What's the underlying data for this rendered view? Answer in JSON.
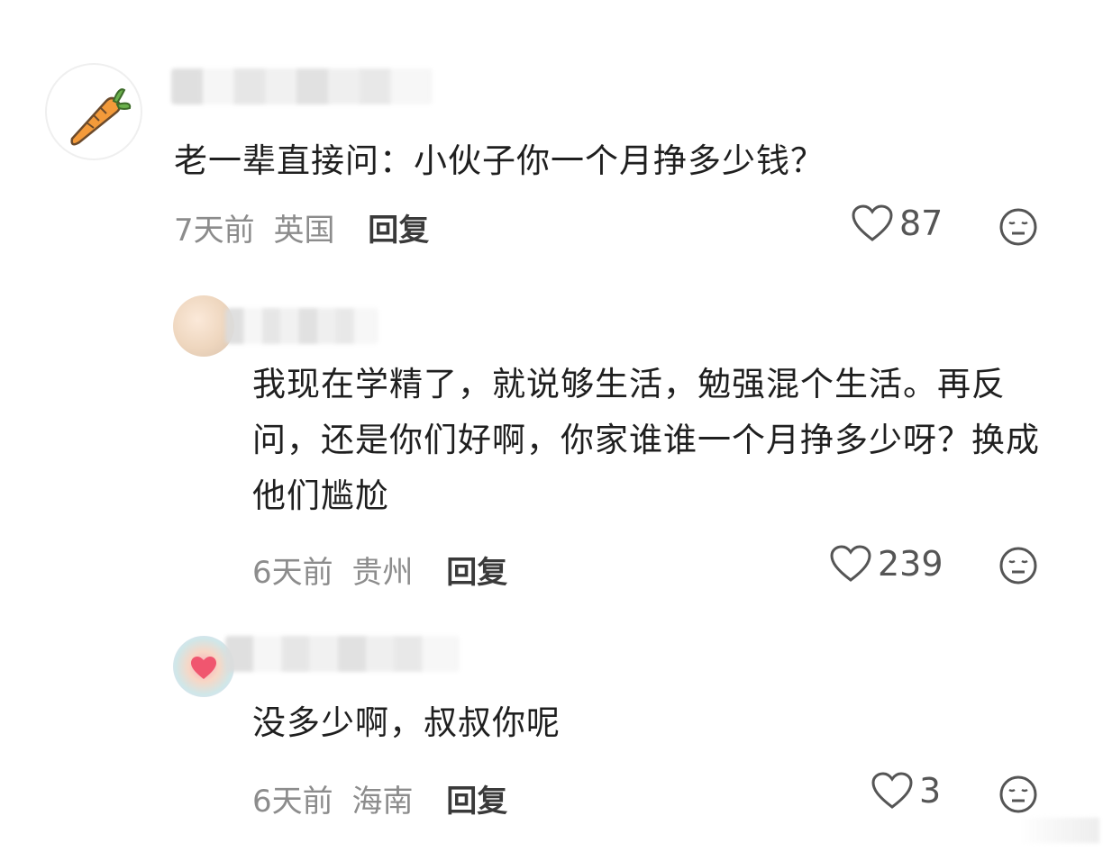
{
  "comments": [
    {
      "text": "老一辈直接问：小伙子你一个月挣多少钱？",
      "time": "7天前",
      "location": "英国",
      "reply_label": "回复",
      "likes": "87"
    },
    {
      "text": "我现在学精了，就说够生活，勉强混个生活。再反问，还是你们好啊，你家谁谁一个月挣多少呀？换成他们尴尬",
      "time": "6天前",
      "location": "贵州",
      "reply_label": "回复",
      "likes": "239"
    },
    {
      "text": "没多少啊，叔叔你呢",
      "time": "6天前",
      "location": "海南",
      "reply_label": "回复",
      "likes": "3"
    }
  ],
  "icons": {
    "avatar_main": "carrot-icon",
    "like": "heart-outline-icon",
    "emoji": "neutral-face-icon"
  },
  "colors": {
    "text": "#1f1f1f",
    "meta": "#8c8c8c",
    "carrot": "#f39a3a",
    "carrot_leaf": "#6ab04c"
  }
}
